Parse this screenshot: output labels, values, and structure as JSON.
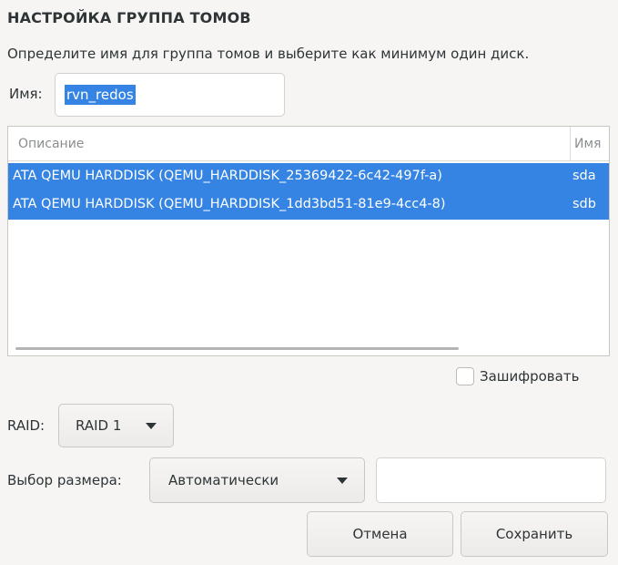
{
  "dialog": {
    "title": "НАСТРОЙКА ГРУППА ТОМОВ",
    "subtitle": "Определите имя для группа томов и выберите как минимум один диск."
  },
  "name_field": {
    "label": "Имя:",
    "value": "rvn_redos"
  },
  "disk_table": {
    "columns": [
      "Описание",
      "Имя"
    ],
    "rows": [
      {
        "description": "ATA QEMU HARDDISK (QEMU_HARDDISK_25369422-6c42-497f-a)",
        "name": "sda",
        "selected": true
      },
      {
        "description": "ATA QEMU HARDDISK (QEMU_HARDDISK_1dd3bd51-81e9-4cc4-8)",
        "name": "sdb",
        "selected": true
      }
    ]
  },
  "encrypt": {
    "label": "Зашифровать",
    "checked": false
  },
  "raid": {
    "label": "RAID:",
    "selected": "RAID 1"
  },
  "size_policy": {
    "label": "Выбор размера:",
    "selected": "Автоматически",
    "entry_value": ""
  },
  "buttons": {
    "cancel": "Отмена",
    "save": "Сохранить"
  },
  "colors": {
    "selection": "#3584e4",
    "background": "#f6f5f4"
  }
}
